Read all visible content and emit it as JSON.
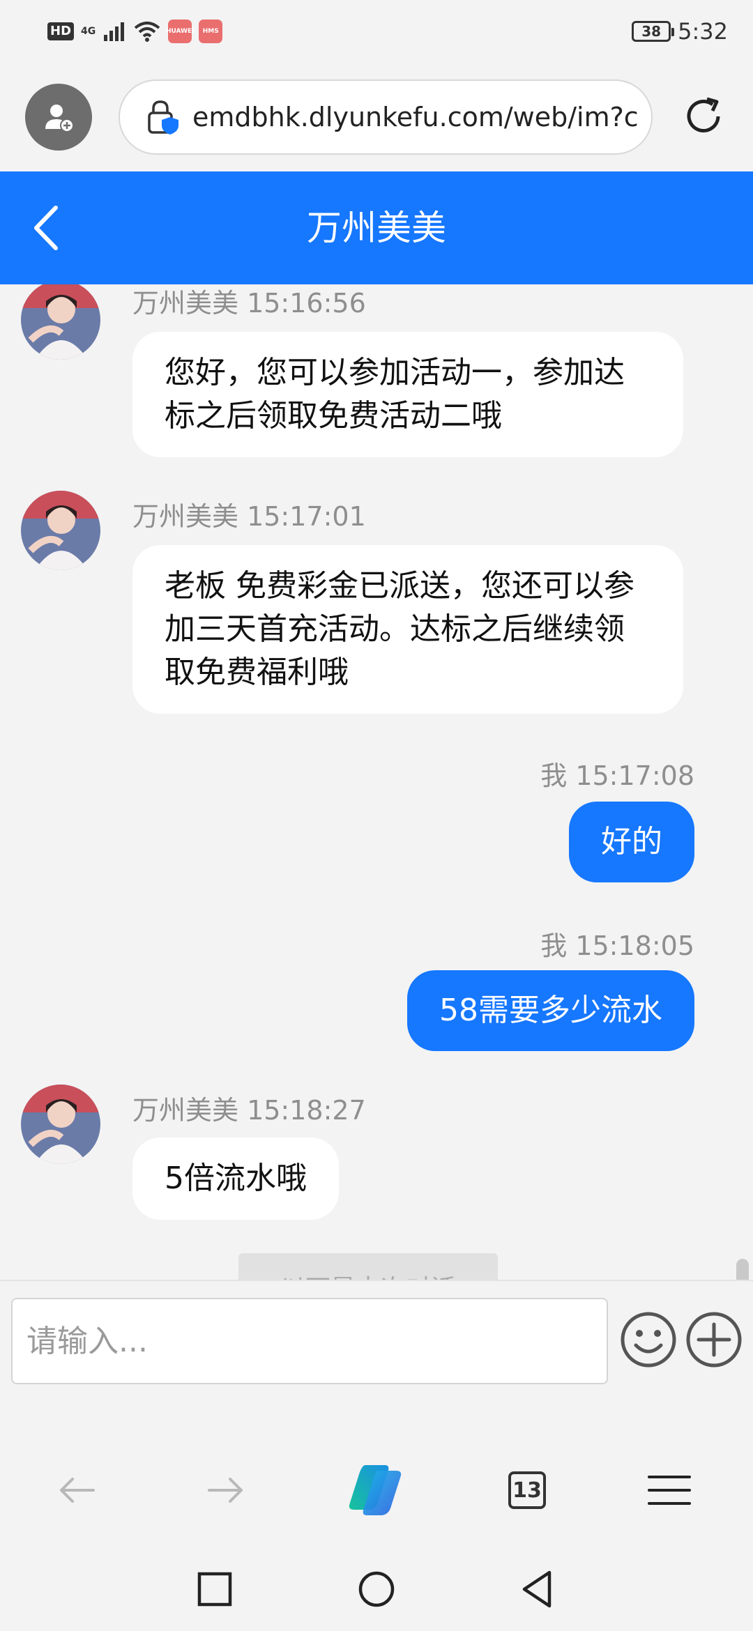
{
  "status_bar": {
    "hd": "HD",
    "network": "4G",
    "app_badge_1": "HUAWEI",
    "app_badge_2": "HMS",
    "battery": "38",
    "time": "5:32"
  },
  "browser": {
    "url": "emdbhk.dlyunkefu.com/web/im?c",
    "tab_count": "13"
  },
  "chat": {
    "title": "万州美美",
    "divider_text": "以下是本次对话",
    "input_placeholder": "请输入...",
    "messages": [
      {
        "direction": "in",
        "sender": "万州美美",
        "time": "15:16:56",
        "meta": "万州美美 15:16:56",
        "text": "您好，您可以参加活动一，参加达标之后领取免费活动二哦"
      },
      {
        "direction": "in",
        "sender": "万州美美",
        "time": "15:17:01",
        "meta": "万州美美 15:17:01",
        "text": "老板 免费彩金已派送，您还可以参加三天首充活动。达标之后继续领取免费福利哦"
      },
      {
        "direction": "out",
        "sender": "我",
        "time": "15:17:08",
        "meta": "我 15:17:08",
        "text": "好的"
      },
      {
        "direction": "out",
        "sender": "我",
        "time": "15:18:05",
        "meta": "我 15:18:05",
        "text": "58需要多少流水"
      },
      {
        "direction": "in",
        "sender": "万州美美",
        "time": "15:18:27",
        "meta": "万州美美 15:18:27",
        "text": "5倍流水哦"
      }
    ]
  },
  "icons": {
    "profile": "profile-add-icon",
    "lock": "site-security-icon",
    "reload": "reload-icon",
    "back": "back-chevron-icon",
    "emoji": "emoji-icon",
    "plus": "plus-icon",
    "nav_back": "arrow-left-icon",
    "nav_forward": "arrow-right-icon",
    "copilot": "copilot-icon",
    "tabs": "tabs-icon",
    "menu": "menu-icon",
    "sys_recent": "square-icon",
    "sys_home": "circle-icon",
    "sys_back": "triangle-back-icon"
  },
  "colors": {
    "accent": "#1677ff",
    "background": "#f3f3f3",
    "bubble_in": "#ffffff",
    "meta_text": "#8e8e8e"
  }
}
